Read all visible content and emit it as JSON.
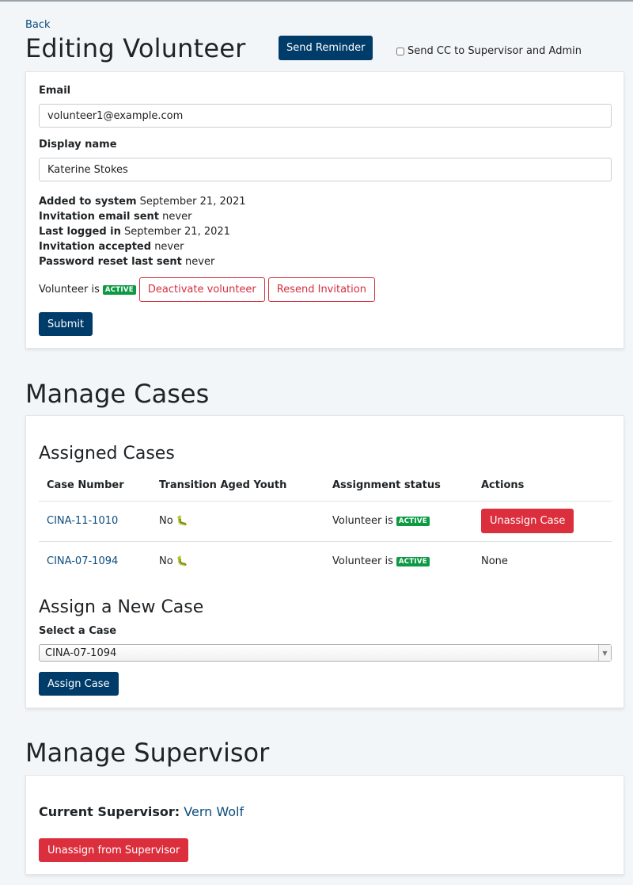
{
  "header": {
    "back_label": "Back",
    "title": "Editing Volunteer",
    "send_reminder_label": "Send Reminder",
    "cc_label": "Send CC to Supervisor and Admin"
  },
  "volunteer_form": {
    "email_label": "Email",
    "email_value": "volunteer1@example.com",
    "display_name_label": "Display name",
    "display_name_value": "Katerine Stokes",
    "info": [
      {
        "label": "Added to system",
        "value": "September 21, 2021"
      },
      {
        "label": "Invitation email sent",
        "value": "never"
      },
      {
        "label": "Last logged in",
        "value": "September 21, 2021"
      },
      {
        "label": "Invitation accepted",
        "value": "never"
      },
      {
        "label": "Password reset last sent",
        "value": "never"
      }
    ],
    "status_prefix": "Volunteer is",
    "status_badge": "ACTIVE",
    "deactivate_label": "Deactivate volunteer",
    "resend_label": "Resend Invitation",
    "submit_label": "Submit"
  },
  "manage_cases": {
    "title": "Manage Cases",
    "assigned_title": "Assigned Cases",
    "columns": [
      "Case Number",
      "Transition Aged Youth",
      "Assignment status",
      "Actions"
    ],
    "rows": [
      {
        "case_number": "CINA-11-1010",
        "transition": "No",
        "transition_icon": "🐛",
        "status_prefix": "Volunteer is",
        "status_badge": "ACTIVE",
        "action": "Unassign Case"
      },
      {
        "case_number": "CINA-07-1094",
        "transition": "No",
        "transition_icon": "🐛",
        "status_prefix": "Volunteer is",
        "status_badge": "ACTIVE",
        "action": "None"
      }
    ],
    "assign_title": "Assign a New Case",
    "select_label": "Select a Case",
    "select_value": "CINA-07-1094",
    "assign_button": "Assign Case"
  },
  "manage_supervisor": {
    "title": "Manage Supervisor",
    "current_label": "Current Supervisor:",
    "supervisor_name": "Vern Wolf",
    "unassign_label": "Unassign from Supervisor"
  },
  "colors": {
    "primary": "#003c6a",
    "danger": "#dc2f3d",
    "active_badge": "#0c9a43",
    "link": "#0b4c7d"
  }
}
